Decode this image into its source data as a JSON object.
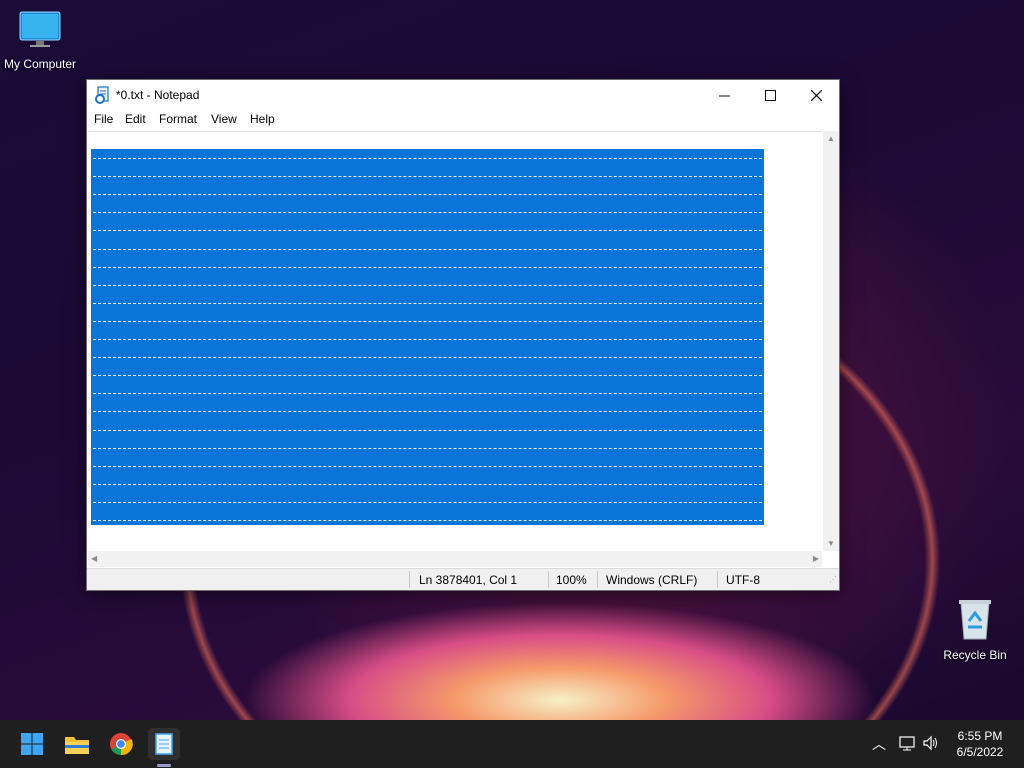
{
  "desktop": {
    "icons": [
      {
        "label": "My Computer"
      },
      {
        "label": "Recycle Bin"
      }
    ]
  },
  "notepad": {
    "title": "*0.txt - Notepad",
    "menu": [
      "File",
      "Edit",
      "Format",
      "View",
      "Help"
    ],
    "selection_color": "#0a74d9",
    "status": {
      "position": "Ln 3878401, Col 1",
      "zoom": "100%",
      "line_ending": "Windows (CRLF)",
      "encoding": "UTF-8"
    }
  },
  "taskbar": {
    "apps": [
      "start-icon",
      "file-explorer-icon",
      "chrome-icon",
      "notepad-icon"
    ],
    "clock": {
      "time": "6:55 PM",
      "date": "6/5/2022"
    }
  }
}
